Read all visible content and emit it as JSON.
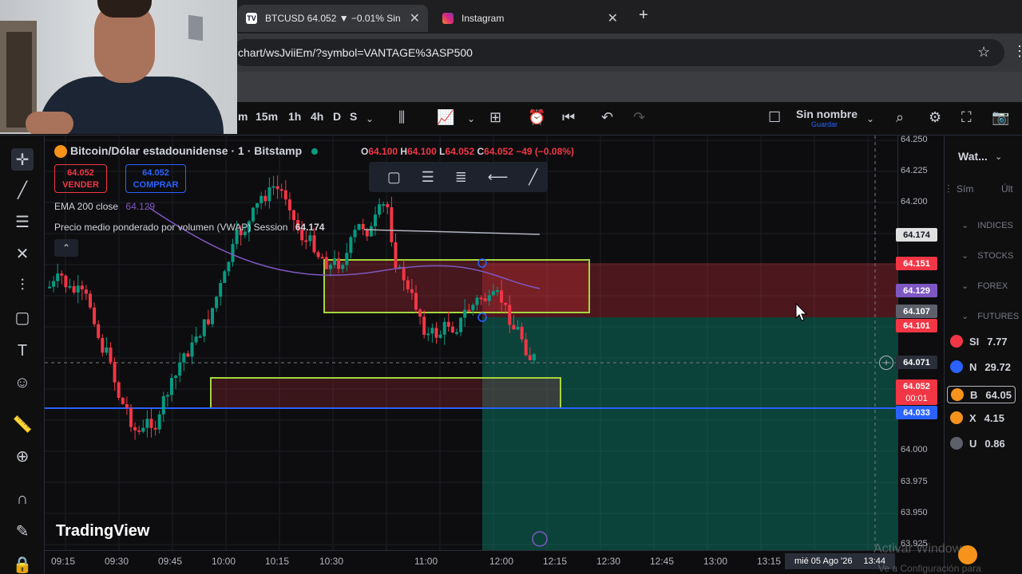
{
  "browser": {
    "tabs": [
      {
        "label": "BTCUSD 64.052 ▼ −0.01% Sin",
        "icon": "tradingview-icon"
      },
      {
        "label": "Instagram",
        "icon": "instagram-icon"
      }
    ],
    "url": "chart/wsJviiEm/?symbol=VANTAGE%3ASP500"
  },
  "toolbar": {
    "intervals": [
      "m",
      "15m",
      "1h",
      "4h",
      "D",
      "S"
    ],
    "layout_name": "Sin nombre",
    "save_label": "Guardar"
  },
  "chart": {
    "symbol_title": "Bitcoin/Dólar estadounidense · 1 · Bitstamp",
    "ohlc": {
      "o": "64.100",
      "h": "64.100",
      "l": "64.052",
      "c": "64.052",
      "change": "−49 (−0.08%)"
    },
    "sell": {
      "price": "64.052",
      "label": "VENDER"
    },
    "buy": {
      "price": "64.052",
      "label": "COMPRAR"
    },
    "ema_label": "EMA 200 close",
    "ema_value": "64.129",
    "vwap_label": "Precio medio ponderado por volumen (VWAP) Session",
    "vwap_value": "64.174",
    "logo": "TradingView",
    "colors": {
      "up": "#089981",
      "down": "#f23645",
      "ema": "#7e57c2",
      "vwap": "#b2b5be",
      "level": "#2962ff"
    }
  },
  "price_axis": {
    "ticks": [
      "64.250",
      "64.225",
      "64.200",
      "64.000",
      "63.975",
      "63.950",
      "63.925"
    ],
    "tags": [
      {
        "text": "64.174",
        "color": "#ffffff",
        "bg": "#e0e0e0",
        "fg": "#131722"
      },
      {
        "text": "64.151",
        "bg": "#f23645",
        "fg": "#ffffff"
      },
      {
        "text": "64.129",
        "bg": "#7e57c2",
        "fg": "#ffffff"
      },
      {
        "text": "64.107",
        "bg": "#5d606b",
        "fg": "#ffffff"
      },
      {
        "text": "64.101",
        "bg": "#f23645",
        "fg": "#ffffff"
      },
      {
        "text": "64.071",
        "bg": "#2a2e39",
        "fg": "#ffffff"
      },
      {
        "text": "64.052",
        "bg": "#f23645",
        "fg": "#ffffff"
      },
      {
        "text": "00:01",
        "bg": "#f23645",
        "fg": "#ffffff"
      },
      {
        "text": "64.033",
        "bg": "#2962ff",
        "fg": "#ffffff"
      }
    ]
  },
  "time_axis": {
    "ticks": [
      "09:15",
      "09:30",
      "09:45",
      "10:00",
      "10:15",
      "10:30",
      "11:00",
      "12:00",
      "12:15",
      "12:30",
      "12:45",
      "13:00",
      "13:15"
    ],
    "crosshair_date": "mié 05 Ago '26",
    "crosshair_time": "13:44"
  },
  "watchlist": {
    "title": "Wat...",
    "col1": "Sím",
    "col2": "Últ",
    "sections": [
      "INDICES",
      "STOCKS",
      "FOREX",
      "FUTURES"
    ],
    "rows": [
      {
        "sym": "SI",
        "val": "7.77",
        "color": "#f23645"
      },
      {
        "sym": "N",
        "val": "29.72",
        "color": "#2962ff"
      },
      {
        "sym": "B",
        "val": "64.05",
        "color": "#f7931a"
      },
      {
        "sym": "X",
        "val": "4.15",
        "color": "#f7931a"
      },
      {
        "sym": "U",
        "val": "0.86",
        "color": "#5d606b"
      }
    ]
  },
  "overlay": {
    "activate_windows": "Activar Windows",
    "activate_windows_sub": "Ve a Configuración para"
  }
}
